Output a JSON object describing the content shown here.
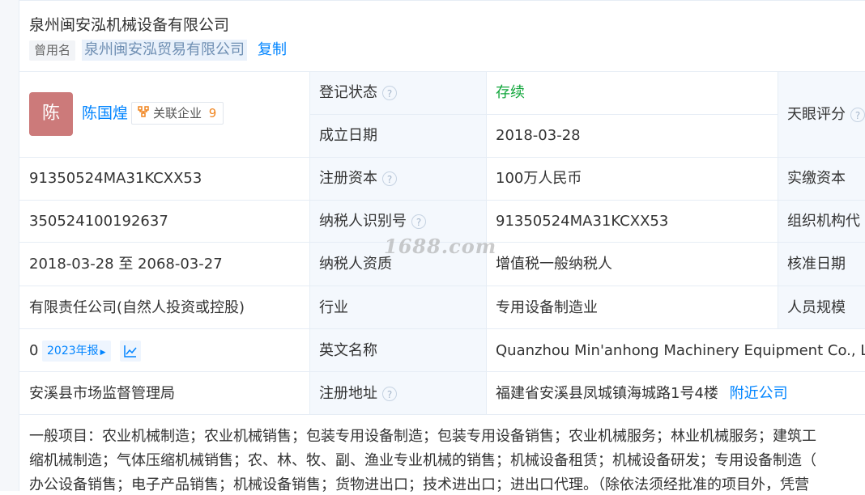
{
  "company": {
    "name": "泉州闽安泓机械设备有限公司",
    "former_name_tag": "曾用名",
    "former_name": "泉州闽安泓贸易有限公司",
    "copy_label": "复制"
  },
  "person": {
    "avatar_char": "陈",
    "name": "陈国煌",
    "related_label": "关联企业",
    "related_count": "9"
  },
  "labels": {
    "reg_status": "登记状态",
    "found_date": "成立日期",
    "reg_capital": "注册资本",
    "tax_id": "纳税人识别号",
    "taxpayer_type": "纳税人资质",
    "industry": "行业",
    "english_name": "英文名称",
    "reg_address": "注册地址",
    "rating": "天眼评分",
    "paid_capital": "实缴资本",
    "org_code": "组织机构代",
    "approve_date": "核准日期",
    "staff_size": "人员规模"
  },
  "values": {
    "reg_status": "存续",
    "found_date": "2018-03-28",
    "credit_code": "91350524MA31KCXX53",
    "reg_capital": "100万人民币",
    "reg_number": "350524100192637",
    "tax_id": "91350524MA31KCXX53",
    "term": "2018-03-28 至 2068-03-27",
    "taxpayer_type": "增值税一般纳税人",
    "company_type": "有限责任公司(自然人投资或控股)",
    "industry": "专用设备制造业",
    "insured": "0",
    "annual_report": "2023年报",
    "english_name": "Quanzhou Min'anhong Machinery Equipment Co., Ltd",
    "authority": "安溪县市场监督管理局",
    "address": "福建省安溪县凤城镇海城路1号4楼",
    "nearby": "附近公司"
  },
  "scope": {
    "line1": "一般项目：农业机械制造；农业机械销售；包装专用设备制造；包装专用设备销售；农业机械服务；林业机械服务；建筑工",
    "line2": "缩机械制造；气体压缩机械销售；农、林、牧、副、渔业专业机械的销售；机械设备租赁；机械设备研发；专用设备制造（",
    "line3": "办公设备销售；电子产品销售；机械设备销售；货物进出口；技术进出口；进出口代理。（除依法须经批准的项目外，凭营"
  },
  "watermark": "1688.com",
  "colors": {
    "status_green": "#11a63b",
    "link_blue": "#0084ff",
    "avatar_bg": "#cc7a7a",
    "label_bg": "#f4f8fd"
  }
}
